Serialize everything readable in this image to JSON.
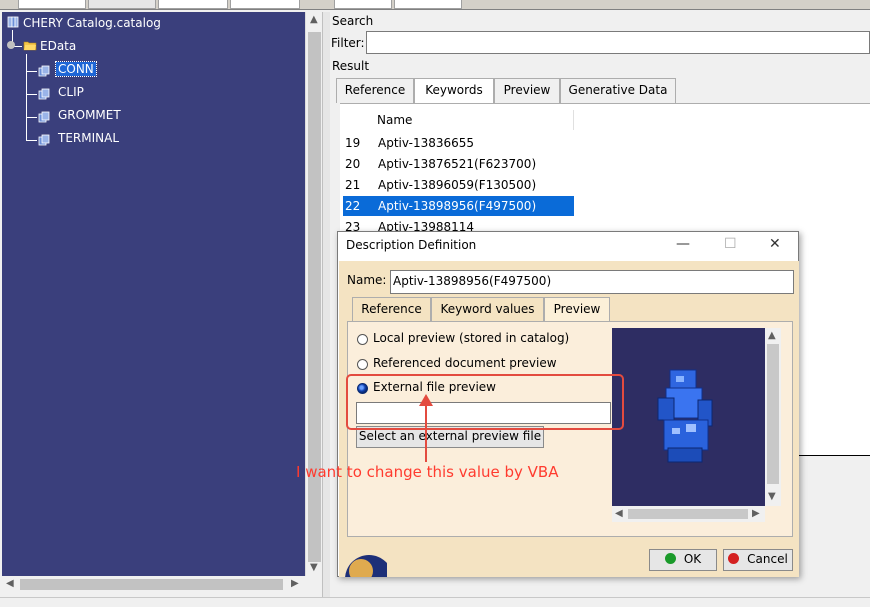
{
  "tree": {
    "root_label": "CHERY Catalog.catalog",
    "chapter_label": "EData",
    "families": [
      "CONN",
      "CLIP",
      "GROMMET",
      "TERMINAL"
    ],
    "selected_family": "CONN"
  },
  "catalog": {
    "search_label": "Search",
    "filter_label": "Filter:",
    "filter_value": "",
    "result_label": "Result",
    "tabs": [
      "Reference",
      "Keywords",
      "Preview",
      "Generative Data"
    ],
    "active_tab": "Keywords",
    "column_header": "Name",
    "rows": [
      {
        "index": "19",
        "name": "Aptiv-13836655"
      },
      {
        "index": "20",
        "name": "Aptiv-13876521(F623700)"
      },
      {
        "index": "21",
        "name": "Aptiv-13896059(F130500)"
      },
      {
        "index": "22",
        "name": "Aptiv-13898956(F497500)"
      },
      {
        "index": "23",
        "name": "Aptiv-13988114"
      }
    ],
    "selected_row": "22"
  },
  "dialog": {
    "title": "Description Definition",
    "minimize_icon": "minimize-icon",
    "maximize_icon": "maximize-icon",
    "close_icon": "close-icon",
    "name_label": "Name:",
    "name_value": "Aptiv-13898956(F497500)",
    "tabs": [
      "Reference",
      "Keyword values",
      "Preview"
    ],
    "active_tab": "Preview",
    "options": [
      {
        "label": "Local preview (stored in catalog)",
        "selected": false
      },
      {
        "label": "Referenced document preview",
        "selected": false
      },
      {
        "label": "External file preview",
        "selected": true
      }
    ],
    "external_path_value": "",
    "select_button": "Select an external preview file",
    "ok_button": "OK",
    "cancel_button": "Cancel",
    "colors": {
      "body": "#f4e3c2",
      "preview_bg": "#2e2d63",
      "ok_dot": "#1a9a2a",
      "cancel_dot": "#d42020"
    }
  },
  "annotation": {
    "text": "I want to change this value by VBA",
    "color": "#e34b3f"
  }
}
